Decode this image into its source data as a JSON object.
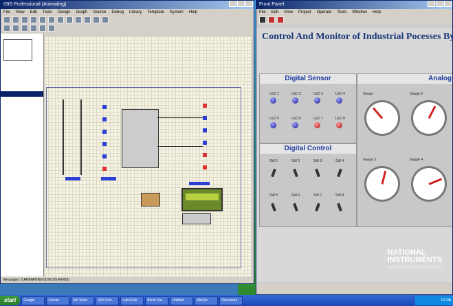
{
  "isis": {
    "title": "ISIS Professional (Animating)",
    "menu": [
      "File",
      "View",
      "Edit",
      "Tools",
      "Design",
      "Graph",
      "Source",
      "Debug",
      "Library",
      "Template",
      "System",
      "Help"
    ],
    "status": "Messages: 0   ANIMATING  00:00:09.400000"
  },
  "labview": {
    "title": "Front Panel",
    "menu": [
      "File",
      "Edit",
      "View",
      "Project",
      "Operate",
      "Tools",
      "Window",
      "Help"
    ],
    "heading": "Control And Monitor of Industrial Pocesses By Mi",
    "digital_sensor": {
      "title": "Digital Sensor",
      "leds": [
        {
          "label": "LED 1",
          "on": false
        },
        {
          "label": "LED 2",
          "on": false
        },
        {
          "label": "LED 3",
          "on": false
        },
        {
          "label": "LED 4",
          "on": false
        },
        {
          "label": "LED 5",
          "on": false
        },
        {
          "label": "LED 6",
          "on": false
        },
        {
          "label": "LED 7",
          "on": true
        },
        {
          "label": "LED 8",
          "on": true
        }
      ]
    },
    "digital_control": {
      "title": "Digital Control",
      "switches": [
        "SW 1",
        "SW 2",
        "SW 3",
        "SW 4",
        "SW 5",
        "SW 6",
        "SW 7",
        "SW 8"
      ]
    },
    "analog": {
      "title": "Analog",
      "gauges": [
        {
          "label": "Gauge",
          "value": 0.35
        },
        {
          "label": "Gauge 2",
          "value": 0.6
        },
        {
          "label": "Gauge 3",
          "value": 0.55
        },
        {
          "label": "Gauge 4",
          "value": 0.75
        }
      ]
    },
    "brand": {
      "line1": "NATIONAL",
      "line2": "INSTRUMENTS",
      "line3": "LabVIEW Evaluation Software"
    }
  },
  "taskbar": {
    "start": "start",
    "tasks": [
      "Google",
      "Screen",
      "MS Word",
      "ISIS Prof...",
      "LabVIEW",
      "Block Dia...",
      "Untitled",
      "WinZip",
      "Document"
    ],
    "clock": "10:06"
  },
  "colors": {
    "title_blue": "#0a246a",
    "heading": "#1e3a7a",
    "group_title": "#1a3aa0",
    "led_on": "#b01010",
    "led_off": "#1a1a8a"
  }
}
